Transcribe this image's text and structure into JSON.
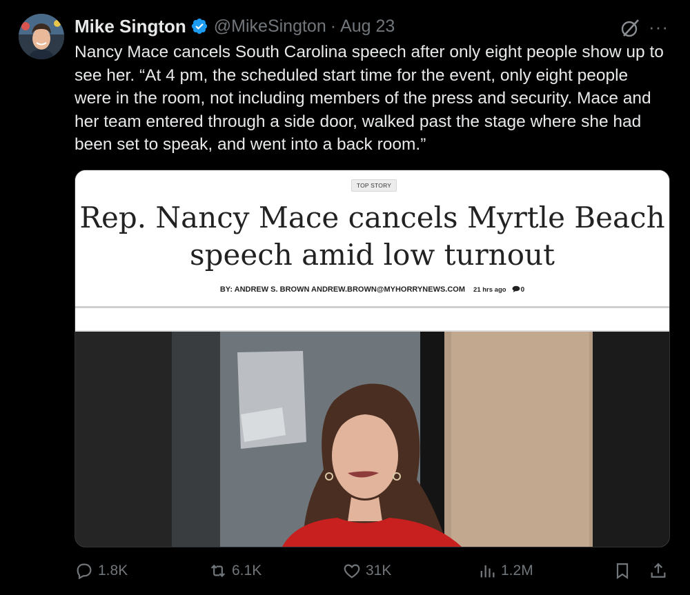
{
  "tweet": {
    "author_name": "Mike Sington",
    "handle": "@MikeSington",
    "separator": "·",
    "date": "Aug 23",
    "text": "Nancy Mace cancels South Carolina speech after only eight people show up to see her. “At 4 pm, the scheduled start time for the event, only eight people were in the room, not including members of the press and security. Mace and her team entered through a side door, walked past the stage where she had been set to speak, and went into a back room.”",
    "more_label": "···"
  },
  "card": {
    "badge": "TOP STORY",
    "headline": "Rep. Nancy Mace cancels Myrtle Beach speech amid low turnout",
    "byline": "BY: ANDREW S. BROWN ANDREW.BROWN@MYHORRYNEWS.COM",
    "time_ago": "21 hrs ago",
    "comment_count": "0"
  },
  "actions": {
    "replies": "1.8K",
    "reposts": "6.1K",
    "likes": "31K",
    "views": "1.2M"
  },
  "icons": {
    "verified": "verified-badge-icon",
    "grok": "grok-icon",
    "reply": "reply-icon",
    "repost": "repost-icon",
    "like": "heart-icon",
    "views": "views-chart-icon",
    "bookmark": "bookmark-icon",
    "share": "share-icon",
    "comment": "comment-bubble-icon"
  },
  "colors": {
    "background": "#000000",
    "text": "#e7e9ea",
    "muted": "#71767b",
    "verified": "#1d9bf0"
  }
}
